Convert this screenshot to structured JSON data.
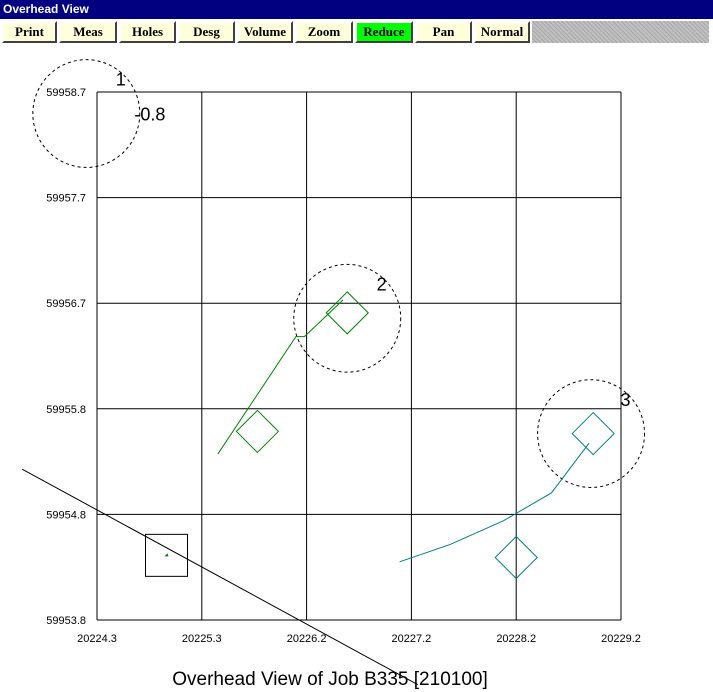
{
  "window": {
    "title": "Overhead View"
  },
  "toolbar": {
    "buttons": [
      {
        "label": "Print",
        "active": false
      },
      {
        "label": "Meas",
        "active": false
      },
      {
        "label": "Holes",
        "active": false
      },
      {
        "label": "Desg",
        "active": false
      },
      {
        "label": "Volume",
        "active": false
      },
      {
        "label": "Zoom",
        "active": false
      },
      {
        "label": "Reduce",
        "active": true
      },
      {
        "label": "Pan",
        "active": false
      },
      {
        "label": "Normal",
        "active": false
      }
    ],
    "active_color": "#00ff00"
  },
  "chart_data": {
    "type": "scatter",
    "title": "Overhead View of Job B335 [210100]",
    "xlabel": "",
    "ylabel": "",
    "x_ticks": [
      "20224.3",
      "20225.3",
      "20226.2",
      "20227.2",
      "20228.2",
      "20229.2"
    ],
    "y_ticks": [
      "59958.7",
      "59957.7",
      "59956.7",
      "59955.8",
      "59954.8",
      "59953.8"
    ],
    "xlim": [
      20224.3,
      20229.2
    ],
    "ylim": [
      59953.8,
      59958.7
    ],
    "grid": true,
    "holes": [
      {
        "label": "1",
        "value_label": "-0.8",
        "x": 20224.2,
        "y": 59958.5,
        "radius": 0.5
      },
      {
        "label": "2",
        "x": 20226.64,
        "y": 59956.6,
        "radius": 0.5,
        "color": "#008000",
        "design_marker": {
          "x": 20226.64,
          "y": 59956.65
        },
        "collar_marker": {
          "x": 20225.8,
          "y": 59955.55
        },
        "trace": [
          [
            20225.43,
            59955.34
          ],
          [
            20226.16,
            59956.43
          ],
          [
            20226.24,
            59956.43
          ],
          [
            20226.6,
            59956.77
          ]
        ]
      },
      {
        "label": "3",
        "x": 20228.92,
        "y": 59955.53,
        "radius": 0.5,
        "color": "#008080",
        "design_marker": {
          "x": 20228.94,
          "y": 59955.53
        },
        "collar_marker": {
          "x": 20228.22,
          "y": 59954.38
        },
        "trace": [
          [
            20227.13,
            59954.34
          ],
          [
            20227.6,
            59954.5
          ],
          [
            20228.1,
            59954.72
          ],
          [
            20228.55,
            59954.98
          ],
          [
            20228.9,
            59955.44
          ]
        ]
      }
    ],
    "reference_box": {
      "x": 20224.95,
      "y": 59954.4
    },
    "reference_line": [
      [
        20223.6,
        59955.2
      ],
      [
        20227.3,
        59953.2
      ]
    ]
  }
}
